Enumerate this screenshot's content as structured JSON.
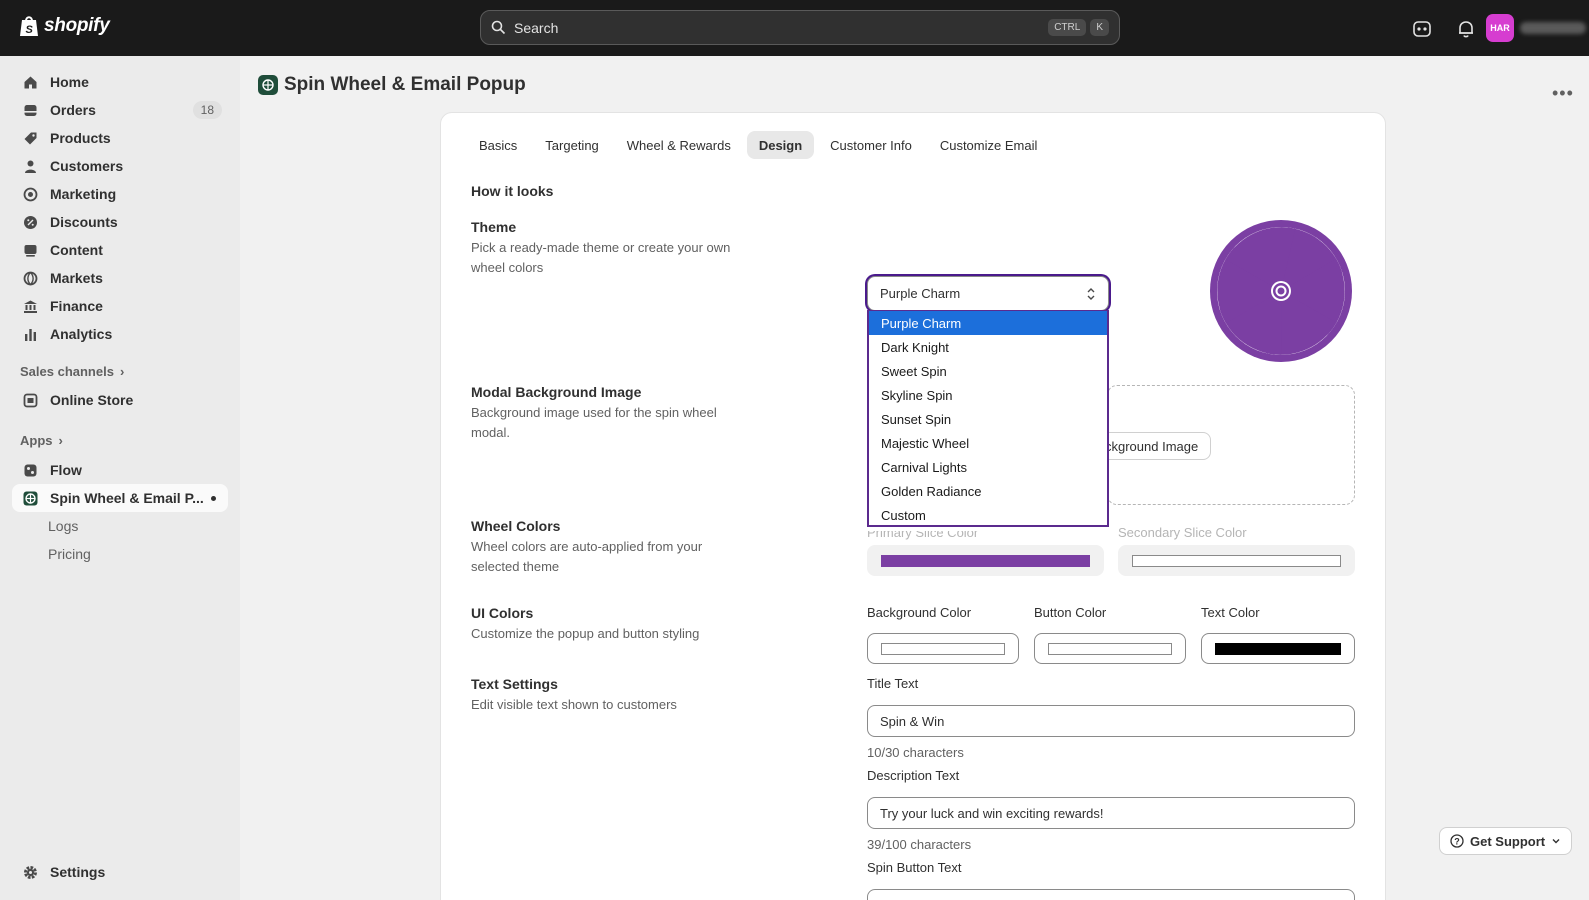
{
  "topbar": {
    "brand": "shopify",
    "search_placeholder": "Search",
    "shortcut_ctrl": "CTRL",
    "shortcut_key": "K",
    "avatar_initials": "HAR"
  },
  "sidebar": {
    "items": [
      {
        "label": "Home",
        "icon": "home-icon"
      },
      {
        "label": "Orders",
        "icon": "orders-icon",
        "badge": "18"
      },
      {
        "label": "Products",
        "icon": "tag-icon"
      },
      {
        "label": "Customers",
        "icon": "person-icon"
      },
      {
        "label": "Marketing",
        "icon": "target-icon"
      },
      {
        "label": "Discounts",
        "icon": "discount-icon"
      },
      {
        "label": "Content",
        "icon": "content-icon"
      },
      {
        "label": "Markets",
        "icon": "globe-icon"
      },
      {
        "label": "Finance",
        "icon": "bank-icon"
      },
      {
        "label": "Analytics",
        "icon": "bar-chart-icon"
      }
    ],
    "sales_channels_label": "Sales channels",
    "online_store": "Online Store",
    "apps_label": "Apps",
    "flow": "Flow",
    "app_active": "Spin Wheel & Email P...",
    "logs": "Logs",
    "pricing": "Pricing",
    "settings": "Settings"
  },
  "page": {
    "title": "Spin Wheel & Email Popup",
    "tabs": [
      "Basics",
      "Targeting",
      "Wheel & Rewards",
      "Design",
      "Customer Info",
      "Customize Email"
    ],
    "active_tab": "Design",
    "how_it_looks": "How it looks"
  },
  "theme": {
    "title": "Theme",
    "desc": "Pick a ready-made theme or create your own wheel colors",
    "selected": "Purple Charm",
    "options": [
      "Purple Charm",
      "Dark Knight",
      "Sweet Spin",
      "Skyline Spin",
      "Sunset Spin",
      "Majestic Wheel",
      "Carnival Lights",
      "Golden Radiance",
      "Custom"
    ]
  },
  "modal_bg": {
    "title": "Modal Background Image",
    "desc": "Background image used for the spin wheel modal.",
    "button_partial": "ckground Image"
  },
  "wheel_colors": {
    "title": "Wheel Colors",
    "desc": "Wheel colors are auto-applied from your selected theme",
    "primary_label": "Primary Slice Color",
    "secondary_label": "Secondary Slice Color",
    "primary_color": "#7b3fa3",
    "secondary_color": "#ffffff"
  },
  "ui_colors": {
    "title": "UI Colors",
    "desc": "Customize the popup and button styling",
    "bg_label": "Background Color",
    "button_label": "Button Color",
    "text_label": "Text Color",
    "bg_color": "#ffffff",
    "button_color": "#ffffff",
    "text_color": "#000000"
  },
  "text_settings": {
    "title": "Text Settings",
    "desc": "Edit visible text shown to customers",
    "title_label": "Title Text",
    "title_value": "Spin & Win",
    "title_count": "10/30 characters",
    "desc_label": "Description Text",
    "desc_value": "Try your luck and win exciting rewards!",
    "desc_count": "39/100 characters",
    "spin_label": "Spin Button Text"
  },
  "support": {
    "label": "Get Support"
  }
}
